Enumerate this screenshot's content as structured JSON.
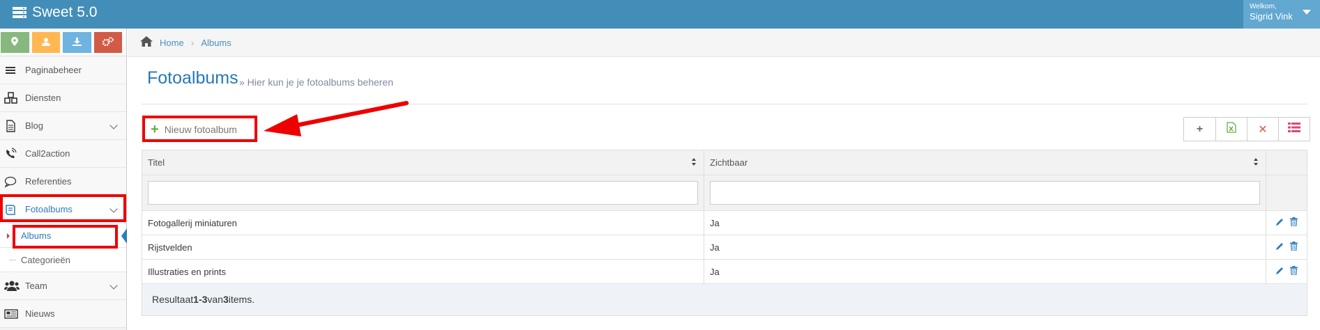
{
  "app": {
    "title": "Sweet 5.0"
  },
  "user": {
    "greeting": "Welkom,",
    "name": "Sigrid Vink"
  },
  "colors": {
    "topbar": "#438eb9",
    "accent": "#2b7dbc",
    "highlight": "#e00000"
  },
  "shortcuts": [
    {
      "icon": "map-marker-icon",
      "color": "#87b87f"
    },
    {
      "icon": "user-icon",
      "color": "#ffb752"
    },
    {
      "icon": "download-icon",
      "color": "#6fb3e0"
    },
    {
      "icon": "cogs-icon",
      "color": "#d15b47"
    }
  ],
  "sidebar": {
    "items": [
      {
        "label": "Paginabeheer",
        "icon": "bars-icon"
      },
      {
        "label": "Diensten",
        "icon": "cubes-icon"
      },
      {
        "label": "Blog",
        "icon": "document-icon"
      },
      {
        "label": "Call2action",
        "icon": "phone-icon"
      },
      {
        "label": "Referenties",
        "icon": "comment-icon"
      },
      {
        "label": "Fotoalbums",
        "icon": "book-icon"
      },
      {
        "label": "Team",
        "icon": "users-icon"
      },
      {
        "label": "Nieuws",
        "icon": "newspaper-icon"
      }
    ],
    "sub": [
      {
        "label": "Albums"
      },
      {
        "label": "Categorieën"
      }
    ]
  },
  "breadcrumb": {
    "home": "Home",
    "current": "Albums"
  },
  "page": {
    "title": "Fotoalbums",
    "subtitle": "» Hier kun je je fotoalbums beheren"
  },
  "toolbar": {
    "new_label": "Nieuw fotoalbum"
  },
  "table": {
    "columns": [
      "Titel",
      "Zichtbaar"
    ],
    "rows": [
      {
        "titel": "Fotogallerij miniaturen",
        "zichtbaar": "Ja"
      },
      {
        "titel": "Rijstvelden",
        "zichtbaar": "Ja"
      },
      {
        "titel": "Illustraties en prints",
        "zichtbaar": "Ja"
      }
    ],
    "footer": {
      "prefix": "Resultaat ",
      "range": "1-3",
      "middle": " van ",
      "total": "3",
      "suffix": " items."
    }
  }
}
